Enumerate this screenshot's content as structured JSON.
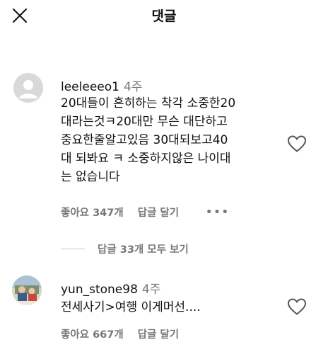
{
  "header": {
    "title": "댓글",
    "close_icon": "close-icon"
  },
  "comments": [
    {
      "username": "leeleeeo1",
      "time": "4주",
      "text": "20대들이 흔히하는 착각 소중한20\n대라는것ㅋ20대만 무슨 대단하고\n중요한줄알고있음 30대되보고40\n대 되봐요 ㅋ 소중하지않은 나이대\n는 없습니다",
      "likes": "좋아요 347개",
      "reply_label": "답글 달기",
      "more_label": "•••",
      "avatar": "default-avatar-icon"
    },
    {
      "username": "yun_stone98",
      "time": "4주",
      "text": "전세사기>여행 이게머선....",
      "likes": "좋아요 667개",
      "reply_label": "답글 달기",
      "avatar": "photo-avatar"
    }
  ],
  "replies_toggle": {
    "label": "답글 33개 모두 보기"
  },
  "colors": {
    "text": "#111111",
    "muted": "#777777",
    "avatar_placeholder": "#d9d9d9"
  }
}
